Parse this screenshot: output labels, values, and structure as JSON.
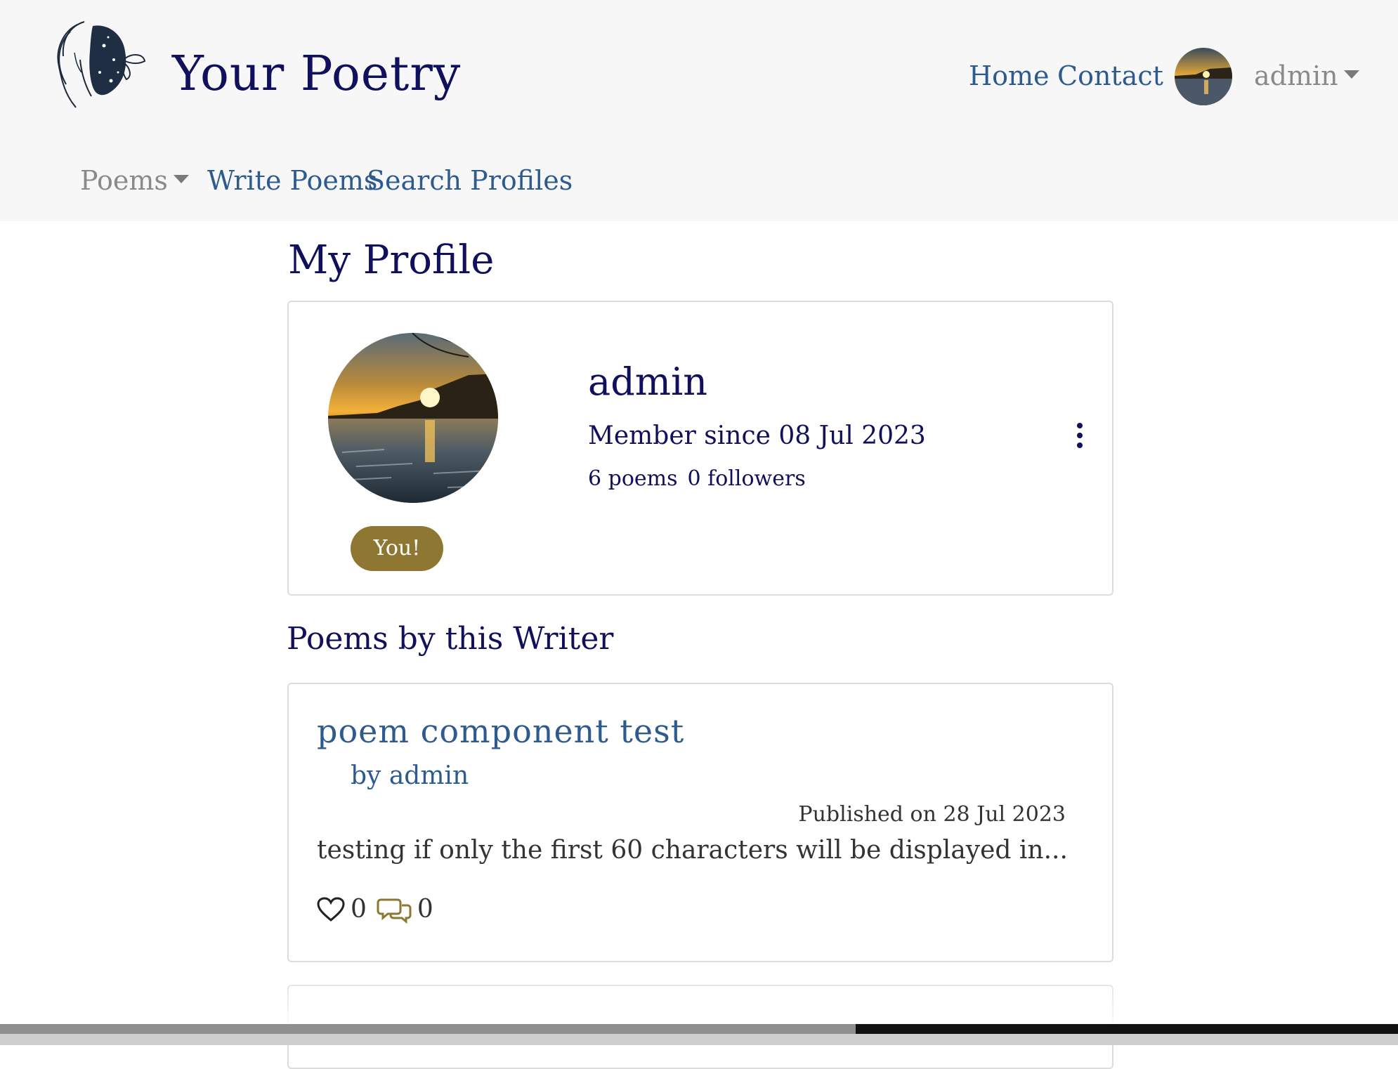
{
  "nav": {
    "brand": "Your Poetry",
    "home": "Home",
    "contact": "Contact",
    "user": "admin",
    "poems": "Poems",
    "write": "Write Poems",
    "search": "Search Profiles"
  },
  "page": {
    "title": "My Profile"
  },
  "profile": {
    "name": "admin",
    "member_since": "Member since 08 Jul 2023",
    "poems_count": "6 poems",
    "followers_count": "0 followers",
    "badge": "You!"
  },
  "poems_section": {
    "title": "Poems by this Writer"
  },
  "poems": [
    {
      "title": "poem component test",
      "author": "by admin",
      "published": "Published on 28 Jul 2023",
      "excerpt": "testing if only the first 60 characters will be displayed in...",
      "likes": "0",
      "comments": "0"
    }
  ],
  "icons": {
    "like": "heart-outline-icon",
    "comments": "chat-bubbles-icon",
    "menu": "kebab-vertical-icon"
  },
  "colors": {
    "primary_dark": "#10105c",
    "link": "#2d5b8f",
    "badge": "#8e7733",
    "navbar_bg": "#f7f7f7"
  }
}
